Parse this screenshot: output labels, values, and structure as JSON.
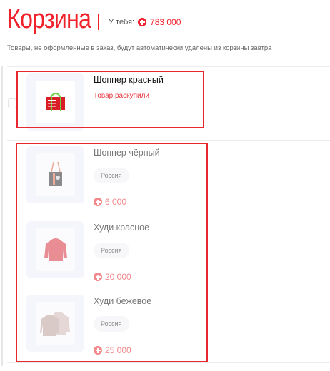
{
  "header": {
    "title": "Корзина",
    "balance_label": "У тебя:",
    "balance_value": "783 000"
  },
  "note": "Товары, не оформленные в заказ, будут автоматически удалены из корзины завтра",
  "sold_out_item": {
    "name": "Шоппер красный",
    "status": "Товар раскупили"
  },
  "items": [
    {
      "name": "Шоппер чёрный",
      "tag": "Россия",
      "price": "6 000"
    },
    {
      "name": "Худи красное",
      "tag": "Россия",
      "price": "20 000"
    },
    {
      "name": "Худи бежевое",
      "tag": "Россия",
      "price": "25 000"
    }
  ],
  "colors": {
    "accent": "#f0232d",
    "highlight": "#e8272f"
  }
}
